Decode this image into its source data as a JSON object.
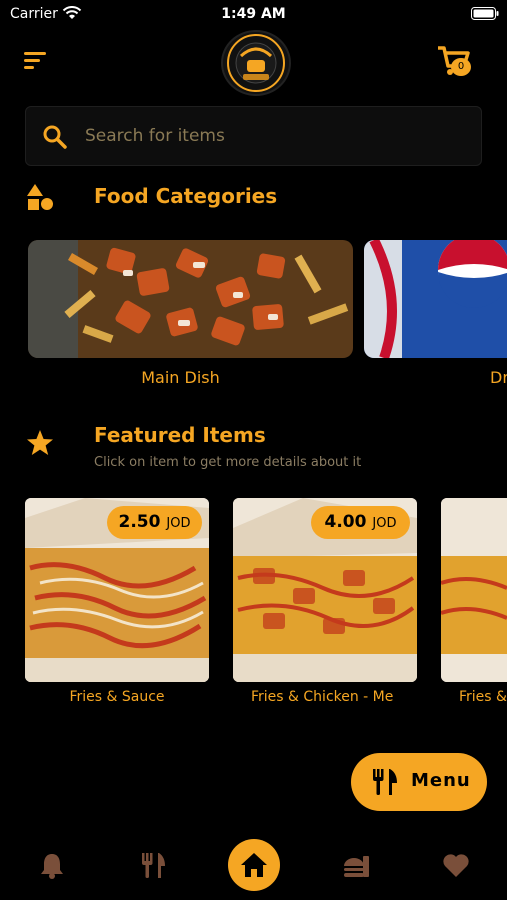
{
  "status_bar": {
    "carrier": "Carrier",
    "time": "1:49 AM"
  },
  "header": {
    "cart_count": "0"
  },
  "search": {
    "placeholder": "Search for items"
  },
  "categories": {
    "title": "Food Categories",
    "items": [
      {
        "label": "Main Dish"
      },
      {
        "label": "Dr"
      }
    ]
  },
  "featured": {
    "title": "Featured Items",
    "subtitle": "Click on item to get more details about it",
    "items": [
      {
        "label": "Fries & Sauce",
        "price": "2.50",
        "currency": "JOD"
      },
      {
        "label": "Fries & Chicken - Me",
        "price": "4.00",
        "currency": "JOD"
      },
      {
        "label": "Fries &"
      }
    ]
  },
  "fab": {
    "label": "Menu"
  },
  "tabs": [
    "notifications",
    "restaurant-menu",
    "home",
    "fast-food",
    "favorites"
  ],
  "colors": {
    "accent": "#f5a623",
    "background": "#000000"
  }
}
